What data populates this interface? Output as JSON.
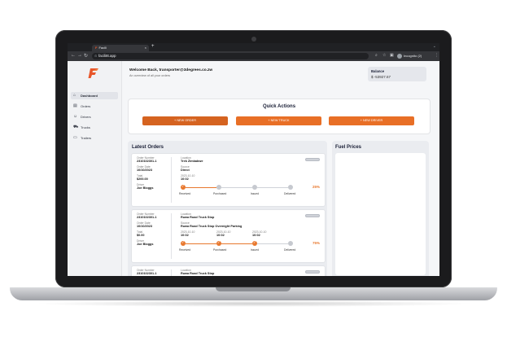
{
  "browser": {
    "tab_title": "Facili",
    "url": "facili8t.app",
    "profile_label": "Incognito (2)"
  },
  "sidebar": {
    "items": [
      {
        "label": "Dashboard",
        "icon": "home-icon",
        "active": true
      },
      {
        "label": "Orders",
        "icon": "clipboard-icon",
        "active": false
      },
      {
        "label": "Drivers",
        "icon": "users-icon",
        "active": false
      },
      {
        "label": "Trucks",
        "icon": "truck-icon",
        "active": false
      },
      {
        "label": "Trailers",
        "icon": "trailer-icon",
        "active": false
      }
    ]
  },
  "header": {
    "welcome": "Welcome Back, transporter@3degrees.co.zw",
    "subtitle": "An overview of all your orders",
    "balance_label": "Balance",
    "balance_value": "$ -53927.67"
  },
  "quick_actions": {
    "title": "Quick Actions",
    "buttons": [
      "+ NEW ORDER",
      "+ NEW TRUCK",
      "+ NEW DRIVER"
    ]
  },
  "latest_orders": {
    "title": "Latest Orders",
    "labels": {
      "order_number": "Order Number",
      "order_date": "Order Date",
      "total": "Total",
      "driver": "Driver",
      "location": "Location",
      "source": "Source"
    },
    "steps": [
      "Received",
      "Purchased",
      "Issued",
      "Delivered"
    ],
    "orders": [
      {
        "order_number": "2310102301-1",
        "order_date": "10/10/2023",
        "total": "$200.00",
        "driver": "Joe Bloggs",
        "location": "Trek Zimbabwe",
        "source": "Direct",
        "step_date": "2023-10-10",
        "step_time": "10:02",
        "progress": "25%"
      },
      {
        "order_number": "2310102301-1",
        "order_date": "10/10/2023",
        "total": "$0.00",
        "driver": "Joe Bloggs",
        "location": "Ruwa Road Truck Stop",
        "source": "Ruwa Road Truck Stop Overnight Parking",
        "step_dates": [
          "2023-10-10",
          "2023-10-10",
          "2023-10-10"
        ],
        "step_times": [
          "10:02",
          "10:02",
          "10:02"
        ],
        "progress": "75%"
      },
      {
        "order_number": "2310102301-1",
        "location": "Ruwa Road Truck Stop"
      }
    ]
  },
  "fuel_prices": {
    "title": "Fuel Prices"
  },
  "colors": {
    "accent": "#e8782e",
    "button": "#e86f26"
  }
}
